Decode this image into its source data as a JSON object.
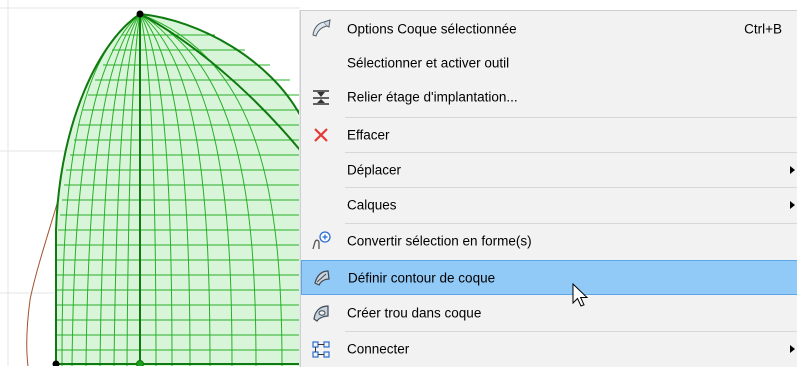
{
  "menu": {
    "items": [
      {
        "label": "Options Coque sélectionnée",
        "shortcut": "Ctrl+B",
        "icon": "shell-settings-icon"
      },
      {
        "label": "Sélectionner et activer outil"
      },
      {
        "label": "Relier étage d'implantation...",
        "icon": "home-story-icon"
      },
      {
        "label": "Effacer",
        "icon": "delete-x-icon"
      },
      {
        "label": "Déplacer",
        "submenu": true
      },
      {
        "label": "Calques",
        "submenu": true
      },
      {
        "label": "Convertir sélection en forme(s)",
        "icon": "convert-morph-icon"
      },
      {
        "label": "Définir contour de coque",
        "icon": "shell-contour-icon",
        "selected": true
      },
      {
        "label": "Créer trou dans coque",
        "icon": "shell-hole-icon"
      },
      {
        "label": "Connecter",
        "icon": "connect-icon",
        "submenu": true
      }
    ]
  },
  "colors": {
    "menu_bg": "#f2f2f2",
    "highlight": "#91c9f7",
    "highlight_border": "#5aa6e6",
    "shell_green": "#1aa01a",
    "shell_fill": "#d9f5d9",
    "delete_red": "#e53935"
  }
}
